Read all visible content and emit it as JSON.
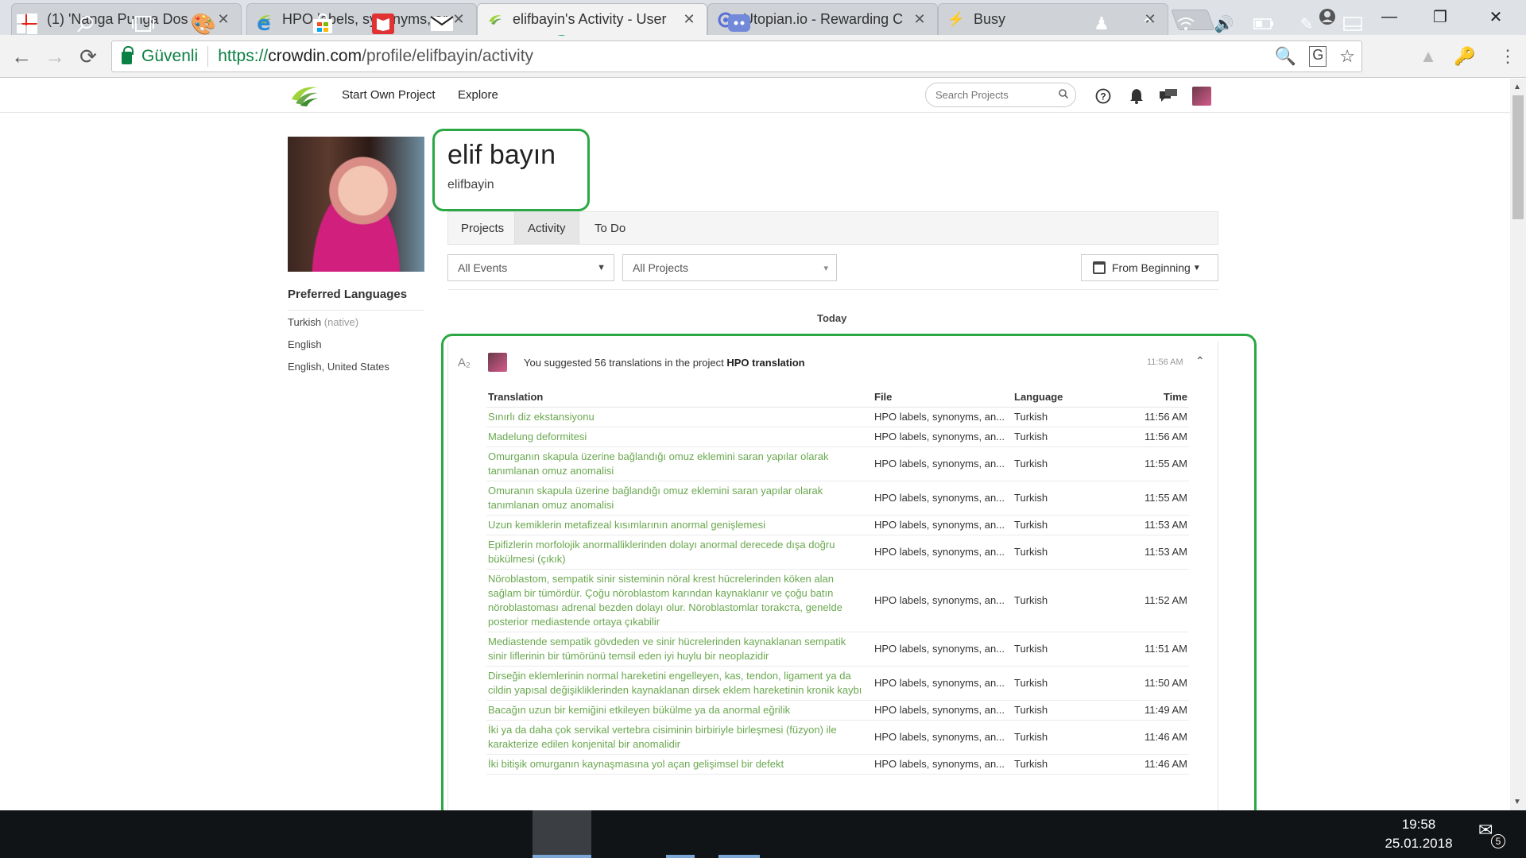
{
  "browser": {
    "tabs": [
      {
        "title": "(1) 'Nanga Punga Dos",
        "favicon": "youtube-icon"
      },
      {
        "title": "HPO labels, synonyms, ar",
        "favicon": "crowdin-icon"
      },
      {
        "title": "elifbayin's Activity - User",
        "favicon": "crowdin-icon",
        "active": true
      },
      {
        "title": "Utopian.io - Rewarding C",
        "favicon": "utopian-icon"
      },
      {
        "title": "Busy",
        "favicon": "busy-icon"
      }
    ],
    "secure_label": "Güvenli",
    "url_scheme": "https://",
    "url_host": "crowdin.com",
    "url_path": "/profile/elifbayin/activity"
  },
  "header": {
    "nav_start": "Start Own Project",
    "nav_explore": "Explore",
    "search_placeholder": "Search Projects"
  },
  "profile": {
    "name": "elif bayın",
    "username": "elifbayin",
    "preferred_languages_title": "Preferred Languages",
    "languages": [
      {
        "name": "Turkish",
        "note": "(native)"
      },
      {
        "name": "English",
        "note": ""
      },
      {
        "name": "English, United States",
        "note": ""
      }
    ]
  },
  "tabs": {
    "projects": "Projects",
    "activity": "Activity",
    "todo": "To Do"
  },
  "filters": {
    "events": "All Events",
    "projects": "All Projects",
    "date": "From Beginning"
  },
  "feed": {
    "day_label": "Today",
    "activity_prefix": "You suggested 56 translations in the project",
    "activity_project": "HPO translation",
    "activity_time": "11:56 AM",
    "columns": {
      "translation": "Translation",
      "file": "File",
      "language": "Language",
      "time": "Time"
    },
    "rows": [
      {
        "translation": "Sınırlı diz ekstansiyonu",
        "file": "HPO labels, synonyms, an...",
        "language": "Turkish",
        "time": "11:56 AM"
      },
      {
        "translation": "Madelung deformitesi",
        "file": "HPO labels, synonyms, an...",
        "language": "Turkish",
        "time": "11:56 AM"
      },
      {
        "translation": "Omurganın skapula üzerine bağlandığı omuz eklemini saran yapılar olarak tanımlanan omuz anomalisi",
        "file": "HPO labels, synonyms, an...",
        "language": "Turkish",
        "time": "11:55 AM"
      },
      {
        "translation": "Omuranın skapula üzerine bağlandığı omuz eklemini saran yapılar olarak tanımlanan omuz anomalisi",
        "file": "HPO labels, synonyms, an...",
        "language": "Turkish",
        "time": "11:55 AM"
      },
      {
        "translation": "Uzun kemiklerin metafizeal kısımlarının anormal genişlemesi",
        "file": "HPO labels, synonyms, an...",
        "language": "Turkish",
        "time": "11:53 AM"
      },
      {
        "translation": "Epifizlerin morfolojik anormalliklerinden dolayı anormal derecede dışa doğru bükülmesi (çıkık)",
        "file": "HPO labels, synonyms, an...",
        "language": "Turkish",
        "time": "11:53 AM"
      },
      {
        "translation": "Nöroblastom, sempatik sinir sisteminin nöral krest hücrelerinden köken alan sağlam bir tümördür. Çoğu nöroblastom karından kaynaklanır ve çoğu batın nöroblastoması adrenal bezden dolayı olur. Nöroblastomlar torakста, genelde posterior mediastende ortaya çıkabilir",
        "file": "HPO labels, synonyms, an...",
        "language": "Turkish",
        "time": "11:52 AM"
      },
      {
        "translation": "Mediastende sempatik gövdeden ve sinir hücrelerinden kaynaklanan sempatik sinir liflerinin bir tümörünü temsil eden iyi huylu bir neoplazidir",
        "file": "HPO labels, synonyms, an...",
        "language": "Turkish",
        "time": "11:51 AM"
      },
      {
        "translation": "Dirseğin eklemlerinin normal hareketini engelleyen, kas, tendon, ligament ya da cildin yapısal değişikliklerinden kaynaklanan dirsek eklem hareketinin kronik kaybı",
        "file": "HPO labels, synonyms, an...",
        "language": "Turkish",
        "time": "11:50 AM"
      },
      {
        "translation": "Bacağın uzun bir kemiğini etkileyen bükülme ya da anormal eğrilik",
        "file": "HPO labels, synonyms, an...",
        "language": "Turkish",
        "time": "11:49 AM"
      },
      {
        "translation": "İki ya da daha çok servikal vertebra cisiminin birbiriyle birleşmesi (füzyon) ile karakterize edilen konjenital bir anomalidir",
        "file": "HPO labels, synonyms, an...",
        "language": "Turkish",
        "time": "11:46 AM"
      },
      {
        "translation": "İki bitişik omurganın kaynaşmasına yol açan gelişimsel bir defekt",
        "file": "HPO labels, synonyms, an...",
        "language": "Turkish",
        "time": "11:46 AM"
      }
    ]
  },
  "taskbar": {
    "time": "19:58",
    "date": "25.01.2018",
    "notification_count": "5"
  },
  "colors": {
    "accent_green": "#6aa84f",
    "annotation_green": "#2aa844",
    "secure_green": "#0b8043"
  }
}
